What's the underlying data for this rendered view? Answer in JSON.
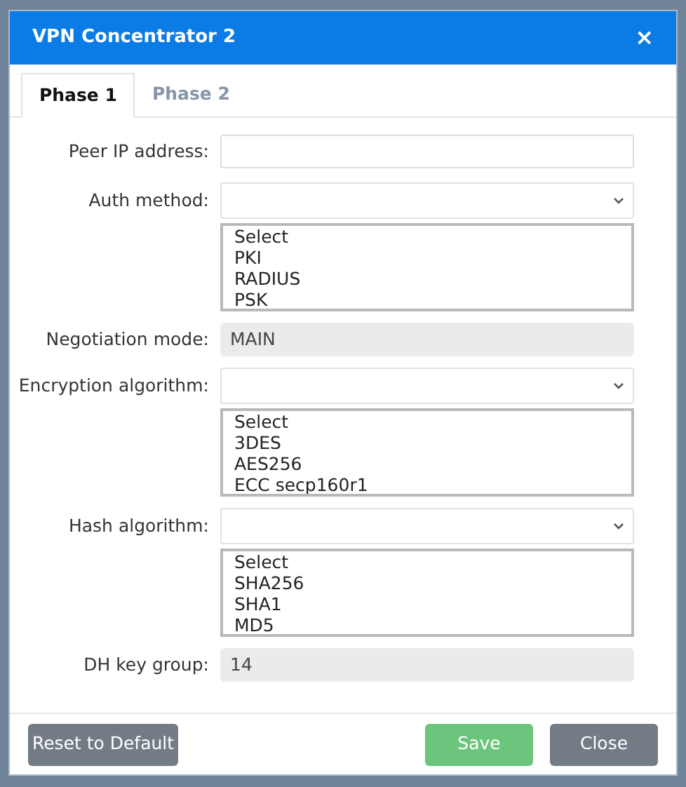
{
  "window": {
    "title": "VPN Concentrator 2",
    "close": "×"
  },
  "tabs": [
    {
      "label": "Phase 1",
      "selected": true
    },
    {
      "label": "Phase 2",
      "selected": false
    }
  ],
  "fields": [
    {
      "kind": "text",
      "label": "Peer IP address:"
    },
    {
      "kind": "select",
      "label": "Auth method:",
      "options": [
        "Select",
        "PKI",
        "RADIUS",
        "PSK"
      ]
    },
    {
      "kind": "readonly",
      "label": "Negotiation mode:",
      "value": "MAIN"
    },
    {
      "kind": "select",
      "label": "Encryption algorithm:",
      "options": [
        "Select",
        "3DES",
        "AES256",
        "ECC secp160r1"
      ]
    },
    {
      "kind": "select",
      "label": "Hash algorithm:",
      "options": [
        "Select",
        "SHA256",
        "SHA1",
        "MD5"
      ]
    },
    {
      "kind": "readonly",
      "label": "DH key group:",
      "value": "14"
    }
  ],
  "buttons": [
    {
      "label": "Reset to Default",
      "kind": "reset"
    },
    {
      "label": "Save",
      "kind": "save"
    },
    {
      "label": "Close",
      "kind": "close"
    }
  ]
}
